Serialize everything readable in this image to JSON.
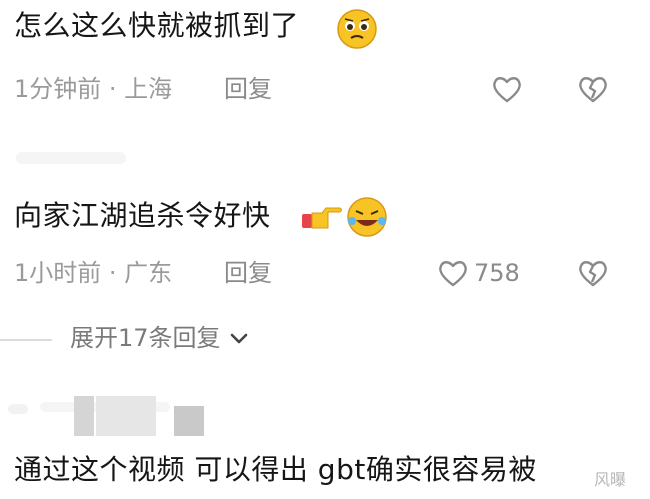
{
  "comments": [
    {
      "text": "怎么这么快就被抓到了",
      "emoji_icon": "pleading-face-icon",
      "time_location": "1分钟前 · 上海",
      "reply_label": "回复",
      "like_count": ""
    },
    {
      "text": "向家江湖追杀令好快",
      "emoji_icon": "pointing-hand-and-laughing-face-icon",
      "time_location": "1小时前 · 广东",
      "reply_label": "回复",
      "like_count": "758"
    },
    {
      "text": "通过这个视频 可以得出 gbt确实很容易被"
    }
  ],
  "expand_replies_label": "展开17条回复",
  "watermark": "风曝",
  "colors": {
    "text": "#161616",
    "meta": "#9a9a9a",
    "icon": "#8a8a8a",
    "emoji_yellow": "#f7c325"
  }
}
